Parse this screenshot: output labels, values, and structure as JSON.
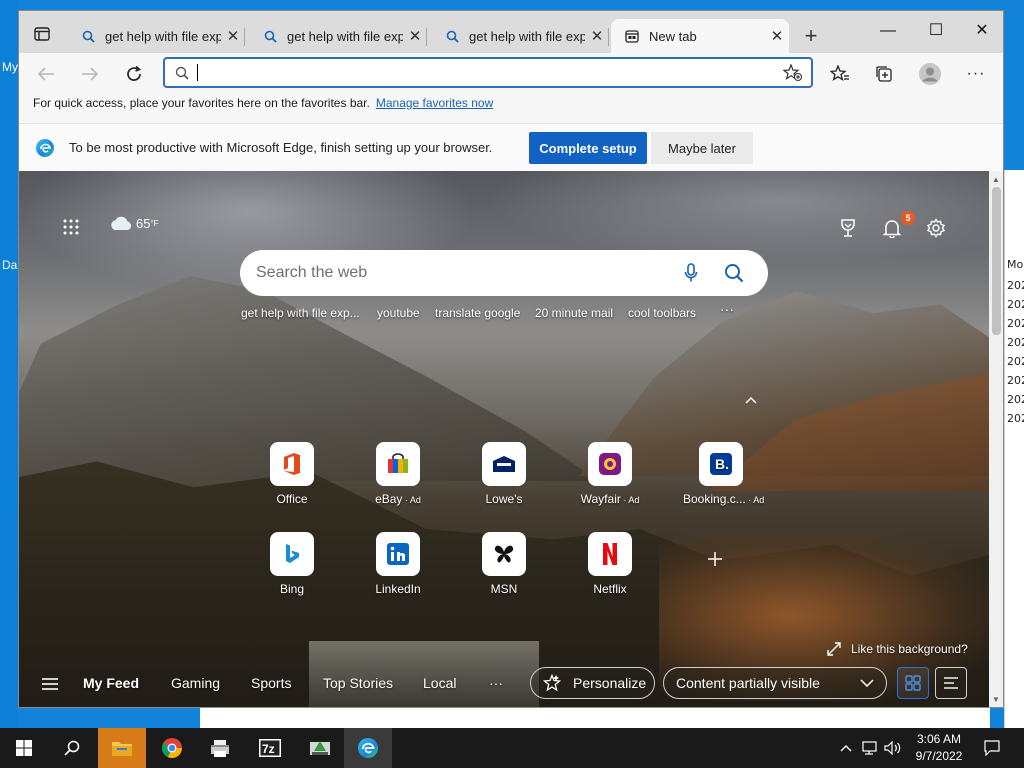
{
  "desktop": {
    "left_labels": [
      "My",
      "Da"
    ],
    "bg_window": {
      "header": "Mo",
      "rows": [
        "202",
        "202",
        "202",
        "202",
        "202",
        "202",
        "202",
        "202"
      ]
    }
  },
  "tabs": [
    {
      "title": "get help with file explorer in windows - Search",
      "active": false
    },
    {
      "title": "get help with file explorer in windows - Search",
      "active": false
    },
    {
      "title": "get help with file explorer in windows - Search",
      "active": false
    },
    {
      "title": "New tab",
      "active": true
    }
  ],
  "address_bar": {
    "value": "",
    "placeholder": ""
  },
  "favorites_bar": {
    "message": "For quick access, place your favorites here on the favorites bar.",
    "link": "Manage favorites now"
  },
  "setup_banner": {
    "message": "To be most productive with Microsoft Edge, finish setting up your browser.",
    "primary": "Complete setup",
    "secondary": "Maybe later"
  },
  "ntp": {
    "weather_temp": "65",
    "weather_unit": "°F",
    "notification_count": "5",
    "search_placeholder": "Search the web",
    "trending": [
      "get help with file exp...",
      "youtube",
      "translate google",
      "20 minute mail",
      "cool toolbars"
    ],
    "more_symbol": "···",
    "quick_links": [
      {
        "label": "Office",
        "ad": ""
      },
      {
        "label": "eBay",
        "ad": " · Ad"
      },
      {
        "label": "Lowe's",
        "ad": ""
      },
      {
        "label": "Wayfair",
        "ad": " · Ad"
      },
      {
        "label": "Booking.c...",
        "ad": " · Ad"
      },
      {
        "label": "Bing",
        "ad": ""
      },
      {
        "label": "LinkedIn",
        "ad": ""
      },
      {
        "label": "MSN",
        "ad": ""
      },
      {
        "label": "Netflix",
        "ad": ""
      }
    ],
    "like_background": "Like this background?",
    "feed": {
      "items": [
        "My Feed",
        "Gaming",
        "Sports",
        "Top Stories",
        "Local"
      ],
      "more": "···",
      "personalize": "Personalize",
      "content_visibility": "Content partially visible"
    }
  },
  "taskbar": {
    "time": "3:06 AM",
    "date": "9/7/2022"
  },
  "colors": {
    "accent": "#1262c3",
    "desktop": "#1283d8",
    "badge": "#e65a1e"
  }
}
